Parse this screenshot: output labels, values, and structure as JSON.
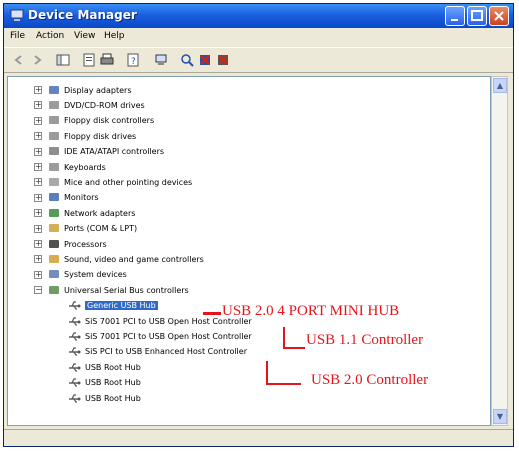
{
  "window": {
    "title": "Device Manager"
  },
  "menu": [
    "File",
    "Action",
    "View",
    "Help"
  ],
  "toolbar_icons": [
    "back-icon",
    "forward-icon",
    "console-tree-icon",
    "properties-icon",
    "print-icon",
    "help-icon",
    "computer-icon",
    "scan-hardware-icon",
    "disable-device-icon",
    "uninstall-device-icon"
  ],
  "tree": {
    "categories": [
      {
        "label": "Display adapters",
        "icon": "display-icon"
      },
      {
        "label": "DVD/CD-ROM drives",
        "icon": "cdrom-icon"
      },
      {
        "label": "Floppy disk controllers",
        "icon": "floppy-controller-icon"
      },
      {
        "label": "Floppy disk drives",
        "icon": "floppy-drive-icon"
      },
      {
        "label": "IDE ATA/ATAPI controllers",
        "icon": "ide-icon"
      },
      {
        "label": "Keyboards",
        "icon": "keyboard-icon"
      },
      {
        "label": "Mice and other pointing devices",
        "icon": "mouse-icon"
      },
      {
        "label": "Monitors",
        "icon": "monitor-icon"
      },
      {
        "label": "Network adapters",
        "icon": "network-icon"
      },
      {
        "label": "Ports (COM & LPT)",
        "icon": "port-icon"
      },
      {
        "label": "Processors",
        "icon": "processor-icon"
      },
      {
        "label": "Sound, video and game controllers",
        "icon": "sound-icon"
      },
      {
        "label": "System devices",
        "icon": "system-icon"
      },
      {
        "label": "Universal Serial Bus controllers",
        "icon": "usb-icon"
      }
    ],
    "usb_children": [
      {
        "label": "Generic USB Hub",
        "selected": true
      },
      {
        "label": "SiS 7001 PCI to USB Open Host Controller",
        "selected": false
      },
      {
        "label": "SiS 7001 PCI to USB Open Host Controller",
        "selected": false
      },
      {
        "label": "SiS PCI to USB Enhanced Host Controller",
        "selected": false
      },
      {
        "label": "USB Root Hub",
        "selected": false
      },
      {
        "label": "USB Root Hub",
        "selected": false
      },
      {
        "label": "USB Root Hub",
        "selected": false
      }
    ]
  },
  "annotations": {
    "hub": "USB 2.0 4 PORT MINI HUB",
    "usb11": "USB 1.1 Controller",
    "usb20": "USB 2.0 Controller"
  },
  "colors": {
    "annotation": "#e3151a",
    "selection": "#316ac5",
    "titlebar": "#0a49c7"
  }
}
